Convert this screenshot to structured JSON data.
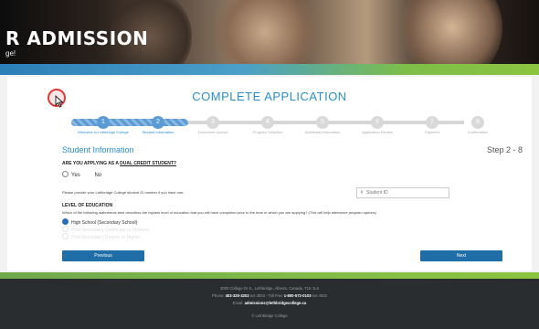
{
  "hero": {
    "title": "R ADMISSION",
    "subtitle": "ge!"
  },
  "page": {
    "heading": "COMPLETE APPLICATION"
  },
  "steps": [
    {
      "num": "1",
      "label": "Welcome to Lethbridge College",
      "state": "done"
    },
    {
      "num": "2",
      "label": "Student Information",
      "state": "active"
    },
    {
      "num": "3",
      "label": "Document Upload",
      "state": "todo"
    },
    {
      "num": "4",
      "label": "Program Selection",
      "state": "todo"
    },
    {
      "num": "5",
      "label": "Additional Information",
      "state": "todo"
    },
    {
      "num": "6",
      "label": "Application Review",
      "state": "todo"
    },
    {
      "num": "7",
      "label": "Payment",
      "state": "todo"
    },
    {
      "num": "8",
      "label": "Confirmation",
      "state": "todo"
    }
  ],
  "section": {
    "title": "Student Information",
    "step_indicator": "Step 2 - 8"
  },
  "dual_credit": {
    "question_prefix": "ARE YOU APPLYING AS A",
    "question_link": "DUAL CREDIT STUDENT?",
    "yes": "Yes",
    "no": "No"
  },
  "student_id": {
    "prompt": "Please provide your Lethbridge College student ID number if you have one:",
    "icon": "#",
    "placeholder": "Student ID"
  },
  "education": {
    "heading": "LEVEL OF EDUCATION",
    "question": "Which of the following statements best describes the highest level of education that you will have completed prior to the term in which you are applying?",
    "hint": "(This will help determine program options)",
    "options": [
      "High School (Secondary School)",
      "Post-Secondary Certificate or Diploma",
      "Post-Secondary Degree or Higher"
    ]
  },
  "buttons": {
    "previous": "Previous",
    "next": "Next"
  },
  "footer": {
    "address": "3000 College Dr S., Lethbridge, Alberta, Canada, T1K 1L6",
    "phone_label": "Phone:",
    "phone": "403-320-3202",
    "phone_ext": "ext 4003 - Toll Free",
    "tollfree": "1-800-572-0103",
    "tollfree_ext": "ext 4003",
    "email_label": "Email:",
    "email": "admissions@lethbridgecollege.ca",
    "copyright": "© Lethbridge College"
  },
  "colors": {
    "accent": "#2a8fcd",
    "button": "#1f6ea8",
    "progress": "#5b9bd5",
    "green": "#8cc43f",
    "footer": "#2a2d30"
  }
}
